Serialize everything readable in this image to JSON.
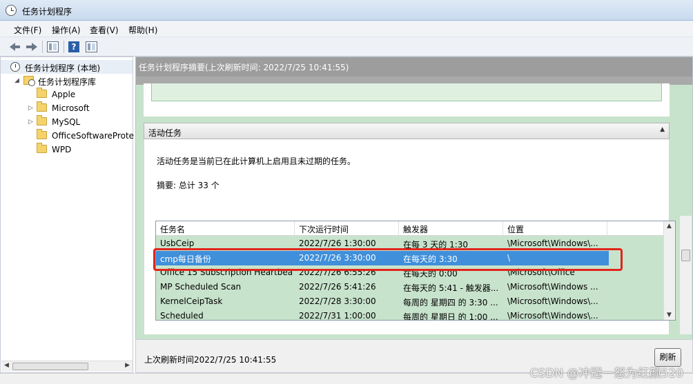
{
  "window": {
    "title": "任务计划程序"
  },
  "menu": [
    "文件(F)",
    "操作(A)",
    "查看(V)",
    "帮助(H)"
  ],
  "toolbar": {
    "back": "back-icon",
    "forward": "forward-icon",
    "show_hide_tree": "console-tree-icon",
    "help": "help-icon",
    "help_glyph": "?",
    "action_pane": "action-pane-icon"
  },
  "tree": {
    "root": "任务计划程序 (本地)",
    "library": "任务计划程序库",
    "folders": [
      "Apple",
      "Microsoft",
      "MySQL",
      "OfficeSoftwareProte",
      "WPD"
    ]
  },
  "summary": {
    "header": "任务计划程序摘要(上次刷新时间: 2022/7/25 10:41:55)"
  },
  "active": {
    "header": "活动任务",
    "description": "活动任务是当前已在此计算机上启用且未过期的任务。",
    "total": "摘要: 总计 33 个",
    "columns": [
      "任务名",
      "下次运行时间",
      "触发器",
      "位置"
    ],
    "rows": [
      [
        "UsbCeip",
        "2022/7/26 1:30:00",
        "在每 3 天的 1:30",
        "\\Microsoft\\Windows\\..."
      ],
      [
        "cmp每日备份",
        "2022/7/26 3:30:00",
        "在每天的 3:30",
        "\\"
      ],
      [
        "Office 15 Subscription Heartbeat",
        "2022/7/26 6:55:26",
        "在每天的 0:00",
        "\\Microsoft\\Office"
      ],
      [
        "MP Scheduled Scan",
        "2022/7/26 5:41:26",
        "在每天的 5:41 - 触发器...",
        "\\Microsoft\\Windows ..."
      ],
      [
        "KernelCeipTask",
        "2022/7/28 3:30:00",
        "每周的 星期四 的 3:30 ...",
        "\\Microsoft\\Windows\\..."
      ],
      [
        "Scheduled",
        "2022/7/31 1:00:00",
        "每周的 星期日 的 1:00 ...",
        "\\Microsoft\\Windows\\..."
      ]
    ],
    "selected_index": 1
  },
  "footer": {
    "last_refresh": "上次刷新时间2022/7/25 10:41:55",
    "refresh_button": "刷新"
  },
  "watermark": "CSDN @冲冠一怒为红颜520",
  "colors": {
    "selection": "#3f8fdb",
    "highlight_box": "#e2231a",
    "pane_bg": "#c8e3cc"
  }
}
